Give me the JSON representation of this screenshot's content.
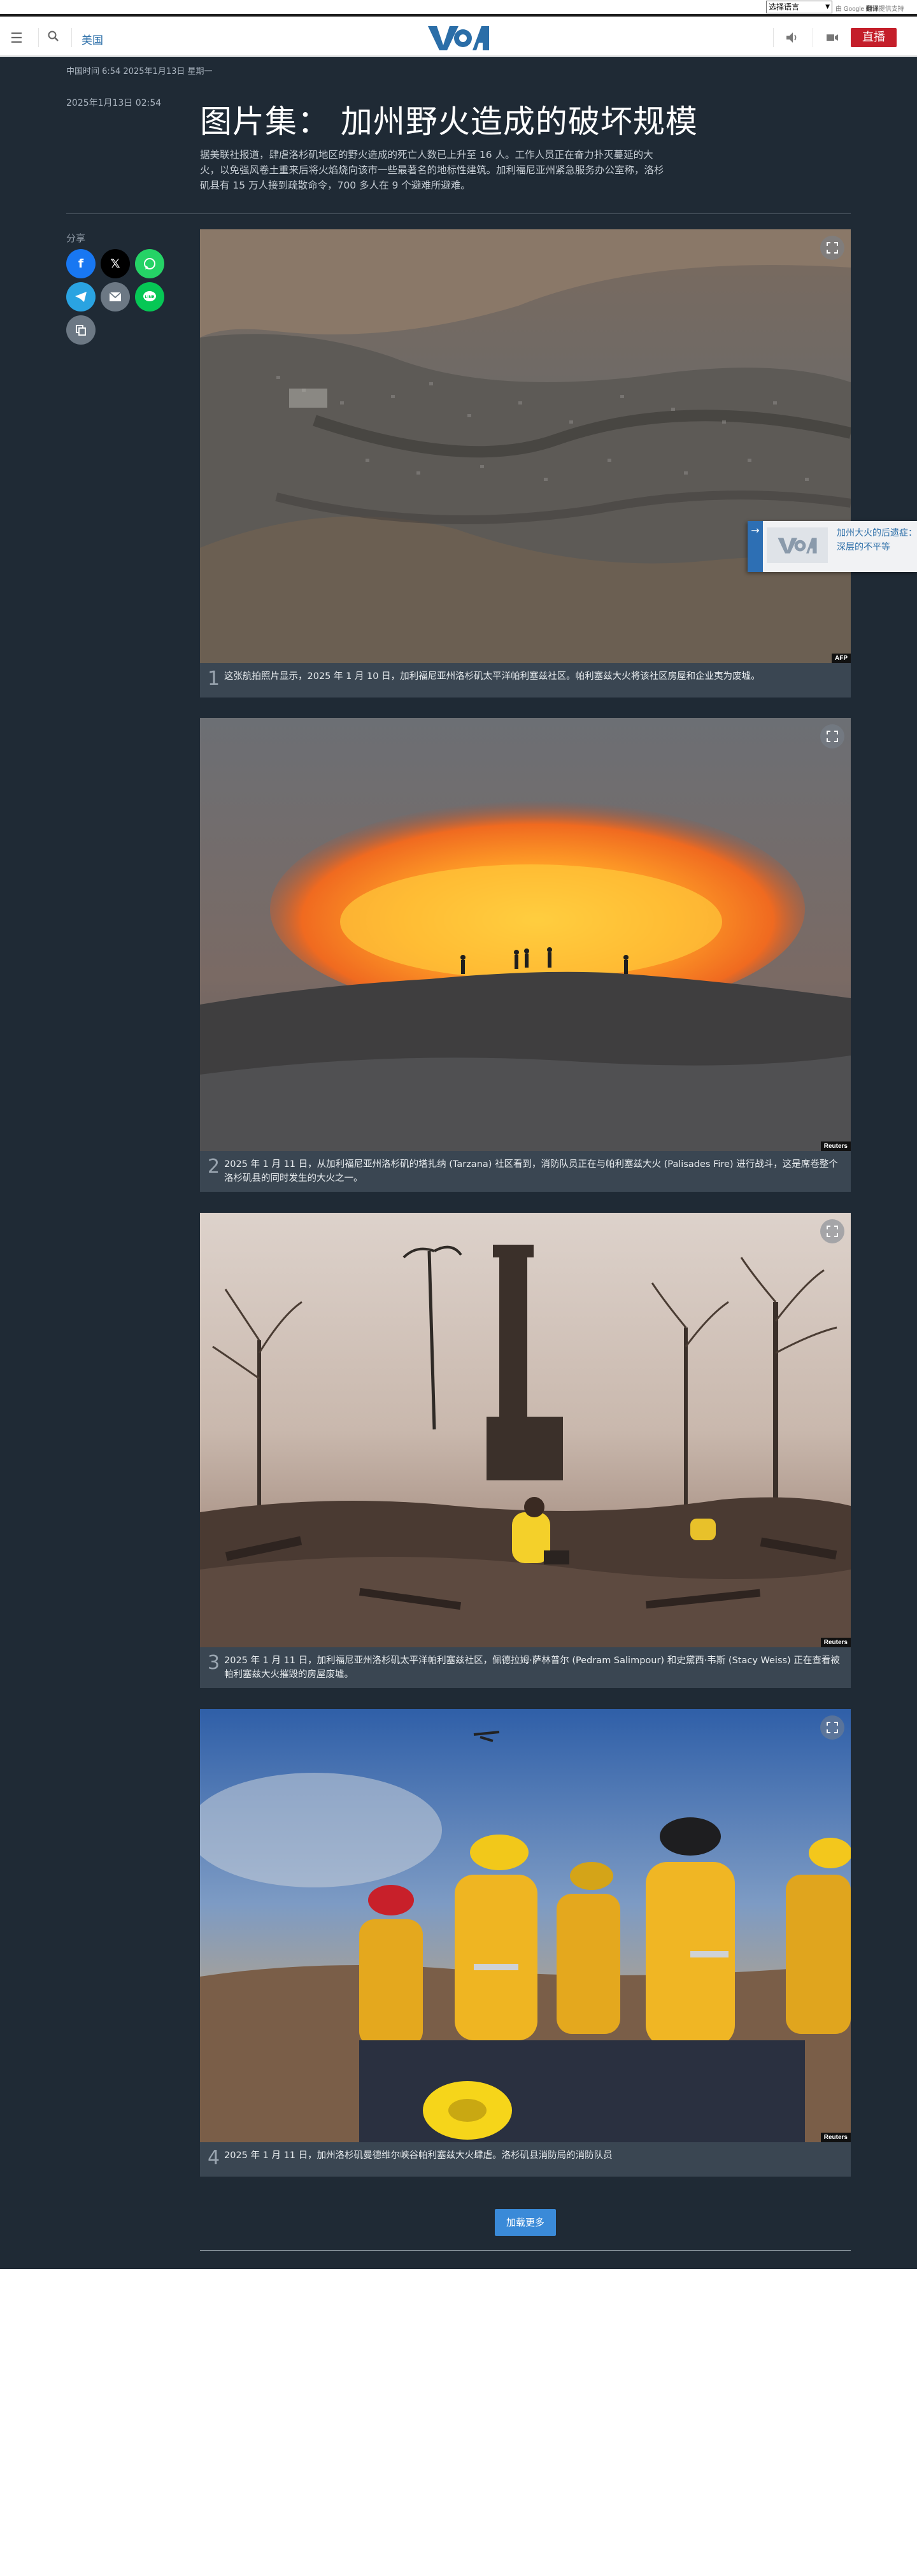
{
  "translate_bar": {
    "select_label": "选择语言",
    "powered_prefix": "由",
    "google": "Google",
    "translate": "翻译",
    "powered_suffix": "提供支持"
  },
  "header": {
    "region": "美国",
    "logo_text": "VOA",
    "live_label": "直播"
  },
  "article": {
    "time_line": "中国时间 6:54 2025年1月13日 星期一",
    "published": "2025年1月13日 02:54",
    "title": "图片集： 加州野火造成的破坏规模",
    "lead": "据美联社报道，肆虐洛杉矶地区的野火造成的死亡人数已上升至 16 人。工作人员正在奋力扑灭蔓延的大火，以免强风卷土重来后将火焰烧向该市一些最著名的地标性建筑。加利福尼亚州紧急服务办公室称，洛杉矶县有 15 万人接到疏散命令，700 多人在 9 个避难所避难。"
  },
  "share": {
    "label": "分享",
    "buttons": [
      "facebook-icon",
      "x-icon",
      "whatsapp-icon",
      "telegram-icon",
      "email-icon",
      "line-icon",
      "copy-link-icon"
    ]
  },
  "gallery": [
    {
      "number": "1",
      "credit": "AFP",
      "caption": "这张航拍照片显示，2025 年 1 月 10 日，加利福尼亚州洛杉矶太平洋帕利塞兹社区。帕利塞兹大火将该社区房屋和企业夷为废墟。"
    },
    {
      "number": "2",
      "credit": "Reuters",
      "caption": "2025 年 1 月 11 日，从加利福尼亚州洛杉矶的塔扎纳 (Tarzana) 社区看到，消防队员正在与帕利塞兹大火 (Palisades Fire) 进行战斗，这是席卷整个洛杉矶县的同时发生的大火之一。"
    },
    {
      "number": "3",
      "credit": "Reuters",
      "caption": "2025 年 1 月 11 日，加利福尼亚州洛杉矶太平洋帕利塞兹社区，佩德拉姆·萨林普尔 (Pedram Salimpour) 和史黛西·韦斯 (Stacy Weiss) 正在查看被帕利塞兹大火摧毁的房屋废墟。"
    },
    {
      "number": "4",
      "credit": "Reuters",
      "caption": "2025 年 1 月 11 日，加州洛杉矶曼德维尔峡谷帕利塞兹大火肆虐。洛杉矶县消防局的消防队员"
    }
  ],
  "load_more": "加载更多",
  "related": {
    "text": "加州大火的后遗症：深层的不平等"
  },
  "colors": {
    "background": "#1f2a35",
    "accent_blue": "#2b6ea8",
    "live_red": "#c41e2a"
  }
}
